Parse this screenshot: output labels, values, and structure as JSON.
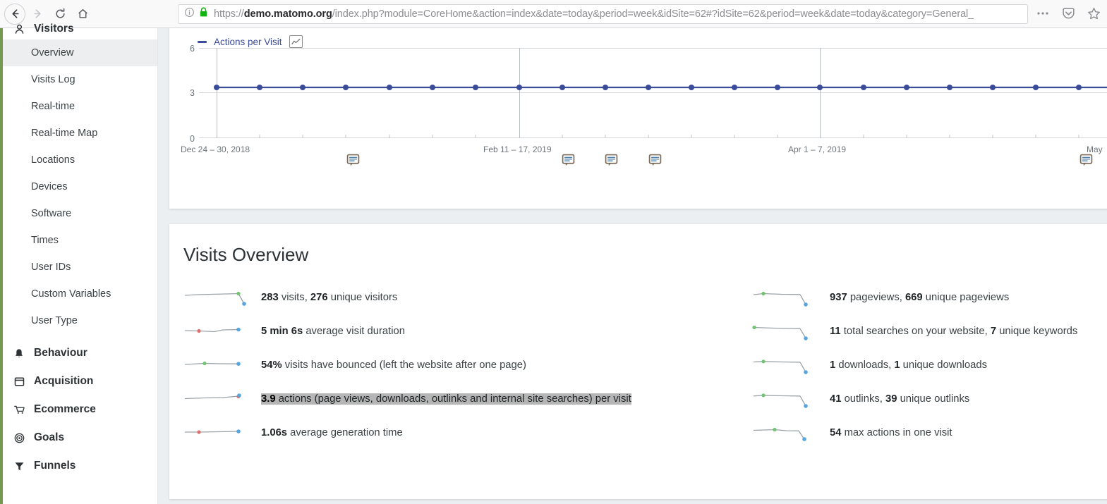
{
  "browser": {
    "back_icon": "back-arrow-icon",
    "forward_icon": "forward-arrow-icon",
    "reload_icon": "reload-icon",
    "home_icon": "home-icon",
    "info_icon": "site-info-icon",
    "lock_icon": "padlock-secure-icon",
    "url_scheme": "https://",
    "url_host": "demo.matomo.org",
    "url_path": "/index.php?module=CoreHome&action=index&date=today&period=week&idSite=62#?idSite=62&period=week&date=today&category=General_",
    "menu_icon": "ellipsis-menu-icon",
    "pocket_icon": "pocket-save-icon",
    "bookmark_icon": "star-bookmark-icon"
  },
  "sidebar": {
    "accent_color": "#769952",
    "groups": [
      {
        "label": "Visitors",
        "icon": "visitors-person-icon",
        "items": [
          {
            "label": "Overview",
            "active": true
          },
          {
            "label": "Visits Log",
            "active": false
          },
          {
            "label": "Real-time",
            "active": false
          },
          {
            "label": "Real-time Map",
            "active": false
          },
          {
            "label": "Locations",
            "active": false
          },
          {
            "label": "Devices",
            "active": false
          },
          {
            "label": "Software",
            "active": false
          },
          {
            "label": "Times",
            "active": false
          },
          {
            "label": "User IDs",
            "active": false
          },
          {
            "label": "Custom Variables",
            "active": false
          },
          {
            "label": "User Type",
            "active": false
          }
        ]
      },
      {
        "label": "Behaviour",
        "icon": "bell-icon",
        "items": []
      },
      {
        "label": "Acquisition",
        "icon": "window-icon",
        "items": []
      },
      {
        "label": "Ecommerce",
        "icon": "cart-icon",
        "items": []
      },
      {
        "label": "Goals",
        "icon": "target-icon",
        "items": []
      },
      {
        "label": "Funnels",
        "icon": "funnel-icon",
        "items": []
      }
    ]
  },
  "evolution_chart": {
    "legend_label": "Actions per Visit",
    "legend_color": "#3a4b9a",
    "chart_type_icon": "chart-type-selector-icon",
    "annotation_icon": "annotation-speech-bubble-icon",
    "annotation_count": 5
  },
  "chart_data": {
    "type": "line",
    "title": "Actions per Visit",
    "xlabel": "",
    "ylabel": "",
    "ylim": [
      0,
      6
    ],
    "yticks": [
      0,
      3,
      6
    ],
    "grid": true,
    "legend": [
      "Actions per Visit"
    ],
    "legend_position": "top-left",
    "x_tick_labels": [
      "Dec 24 – 30, 2018",
      "Feb 11 – 17, 2019",
      "Apr 1 – 7, 2019",
      "May"
    ],
    "x_tick_indices": [
      0,
      7,
      14,
      20
    ],
    "series": [
      {
        "name": "Actions per Visit",
        "color": "#3a4b9a",
        "values": [
          3.4,
          3.4,
          3.4,
          3.4,
          3.4,
          3.4,
          3.4,
          3.4,
          3.4,
          3.4,
          3.4,
          3.4,
          3.4,
          3.4,
          3.4,
          3.4,
          3.4,
          3.4,
          3.4,
          3.4,
          3.4
        ]
      }
    ],
    "annotations_at_indices": [
      3,
      8,
      9,
      10,
      20
    ]
  },
  "visits_overview": {
    "title": "Visits Overview",
    "sparkline_line_color": "#9aa3a8",
    "sparkline_max_color": "#72c472",
    "sparkline_end_color": "#56a7e0",
    "left_metrics": [
      {
        "value": "283",
        "text_after": " visits, ",
        "value2": "276",
        "text_end": " unique visitors",
        "highlighted": false,
        "spark": "dropdown"
      },
      {
        "value": "5 min 6s",
        "text_after": " average visit duration",
        "value2": "",
        "text_end": "",
        "highlighted": false,
        "spark": "flatred"
      },
      {
        "value": "54%",
        "text_after": " visits have bounced (left the website after one page)",
        "value2": "",
        "text_end": "",
        "highlighted": false,
        "spark": "flatgreen"
      },
      {
        "value": "3.9",
        "text_after": " actions (page views, downloads, outlinks and internal site searches) per visit",
        "value2": "",
        "text_end": "",
        "highlighted": true,
        "spark": "flatup"
      },
      {
        "value": "1.06s",
        "text_after": " average generation time",
        "value2": "",
        "text_end": "",
        "highlighted": false,
        "spark": "flatred"
      }
    ],
    "right_metrics": [
      {
        "value": "937",
        "text_after": " pageviews, ",
        "value2": "669",
        "text_end": " unique pageviews",
        "highlighted": false,
        "spark": "dropdown"
      },
      {
        "value": "11",
        "text_after": " total searches on your website, ",
        "value2": "7",
        "text_end": " unique keywords",
        "highlighted": false,
        "spark": "dropdown"
      },
      {
        "value": "1",
        "text_after": " downloads, ",
        "value2": "1",
        "text_end": " unique downloads",
        "highlighted": false,
        "spark": "dropdown"
      },
      {
        "value": "41",
        "text_after": " outlinks, ",
        "value2": "39",
        "text_end": " unique outlinks",
        "highlighted": false,
        "spark": "dropdown"
      },
      {
        "value": "54",
        "text_after": " max actions in one visit",
        "value2": "",
        "text_end": "",
        "highlighted": false,
        "spark": "dropdown"
      }
    ]
  }
}
